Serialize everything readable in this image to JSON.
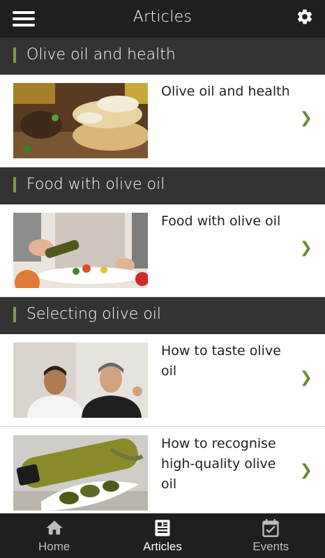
{
  "header": {
    "title": "Articles",
    "menu_icon": "hamburger-menu-icon",
    "settings_icon": "gear-icon"
  },
  "colors": {
    "bar": "#221e1f",
    "section": "#333333",
    "accent": "#7d9a4a",
    "chevron": "#6c8a37"
  },
  "sections": [
    {
      "label": "Olive oil and health",
      "articles": [
        {
          "title": "Olive oil and health",
          "image": "bread-with-olive-oil-photo"
        }
      ]
    },
    {
      "label": "Food with olive oil",
      "articles": [
        {
          "title": "Food with olive oil",
          "image": "pouring-olive-oil-photo"
        }
      ]
    },
    {
      "label": "Selecting olive oil",
      "articles": [
        {
          "title": "How to taste olive oil",
          "image": "chefs-tasting-photo"
        },
        {
          "title": "How to recognise high-quality olive oil",
          "image": "olive-oil-bottle-photo"
        }
      ]
    }
  ],
  "chevron_glyph": "❯",
  "nav": {
    "items": [
      {
        "label": "Home",
        "icon": "home-icon",
        "active": false
      },
      {
        "label": "Articles",
        "icon": "articles-icon",
        "active": true
      },
      {
        "label": "Events",
        "icon": "calendar-check-icon",
        "active": false
      }
    ]
  }
}
